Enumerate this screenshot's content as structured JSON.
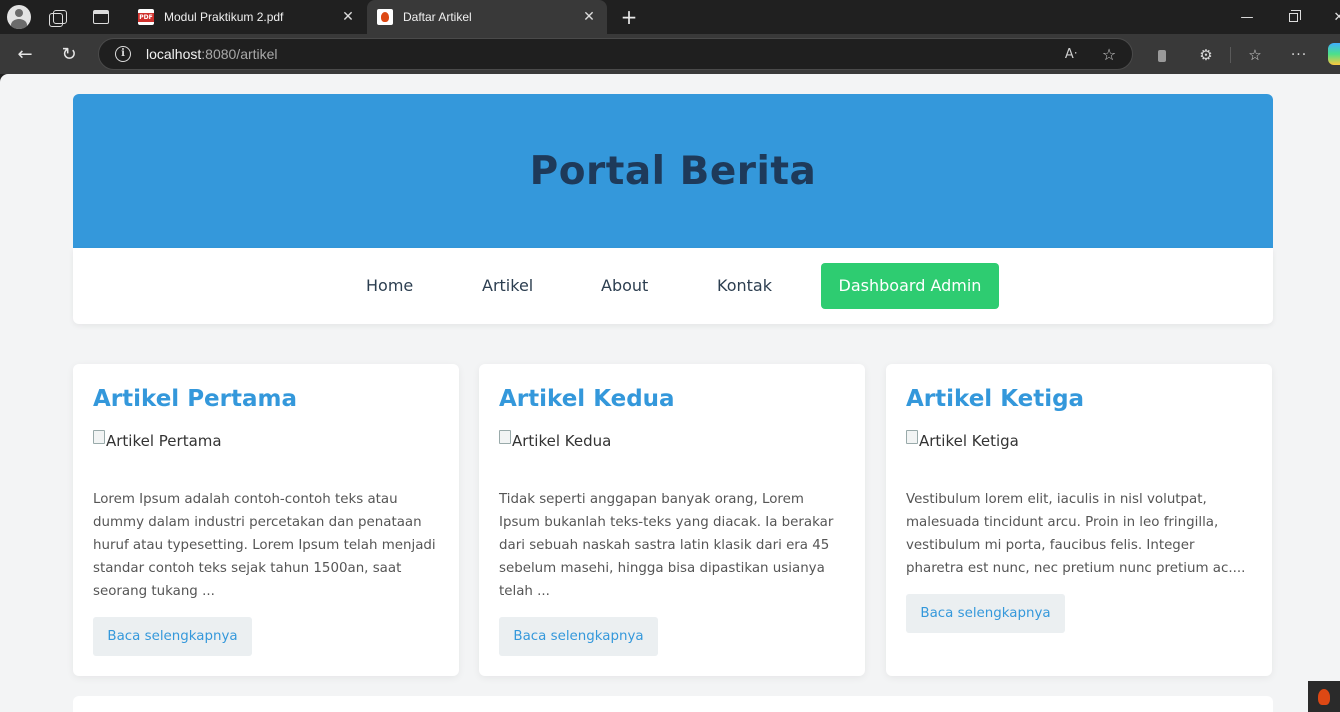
{
  "browser": {
    "tabs": [
      {
        "title": "Modul Praktikum 2.pdf",
        "favicon": "pdf-icon",
        "active": false
      },
      {
        "title": "Daftar Artikel",
        "favicon": "codeigniter-flame-icon",
        "active": true
      }
    ],
    "url_host": "localhost",
    "url_rest": ":8080/artikel"
  },
  "site": {
    "title": "Portal Berita",
    "colors": {
      "header": "#3498db",
      "admin_button": "#2ecc71",
      "link": "#3498db"
    }
  },
  "nav": {
    "home": "Home",
    "artikel": "Artikel",
    "about": "About",
    "kontak": "Kontak",
    "admin": "Dashboard Admin"
  },
  "articles": [
    {
      "title": "Artikel Pertama",
      "image_alt": "Artikel Pertama",
      "excerpt": "Lorem Ipsum adalah contoh-contoh teks atau dummy dalam industri percetakan dan penataan huruf atau typesetting. Lorem Ipsum telah menjadi standar contoh teks sejak tahun 1500an, saat seorang tukang ...",
      "read_more": "Baca selengkapnya"
    },
    {
      "title": "Artikel Kedua",
      "image_alt": "Artikel Kedua",
      "excerpt": "Tidak seperti anggapan banyak orang, Lorem Ipsum bukanlah teks-teks yang diacak. Ia berakar dari sebuah naskah sastra latin klasik dari era 45 sebelum masehi, hingga bisa dipastikan usianya telah ...",
      "read_more": "Baca selengkapnya"
    },
    {
      "title": "Artikel Ketiga",
      "image_alt": "Artikel Ketiga",
      "excerpt": "Vestibulum lorem elit, iaculis in nisl volutpat, malesuada tincidunt arcu. Proin in leo fringilla, vestibulum mi porta, faucibus felis. Integer pharetra est nunc, nec pretium nunc pretium ac....",
      "read_more": "Baca selengkapnya"
    }
  ]
}
